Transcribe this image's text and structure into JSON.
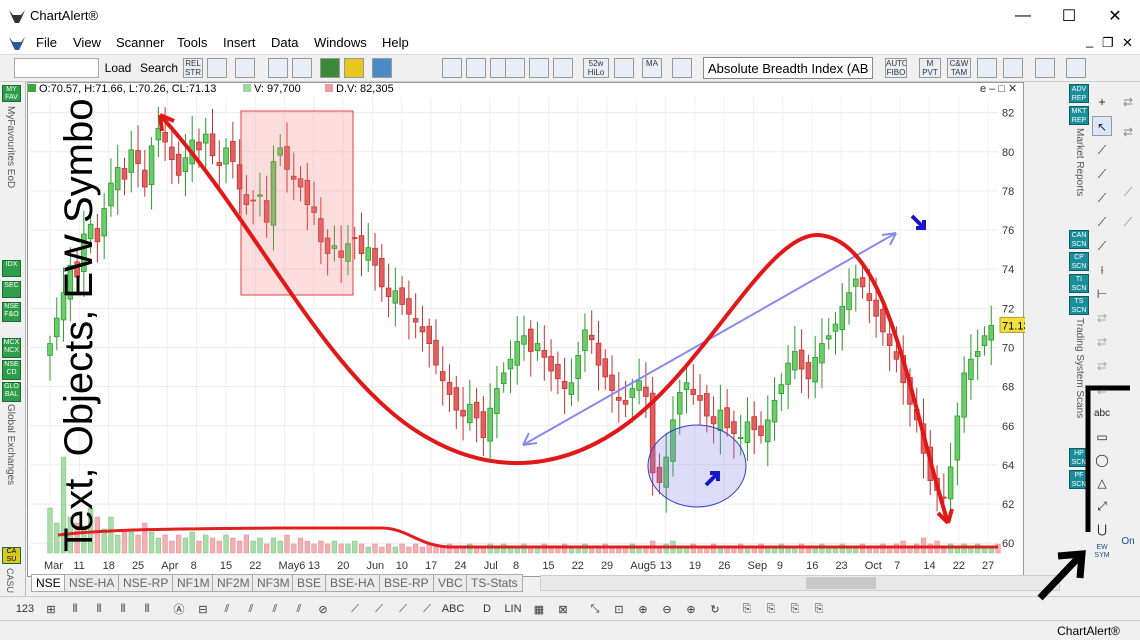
{
  "window": {
    "title": "ChartAlert®",
    "minimize": "—",
    "maximize": "☐",
    "close": "✕"
  },
  "menu": [
    "File",
    "View",
    "Scanner",
    "Tools",
    "Insert",
    "Data",
    "Windows",
    "Help"
  ],
  "menu_right": {
    "min": "_",
    "restore": "❐",
    "close": "✕"
  },
  "toolbar": {
    "load_label": "Load",
    "search_label": "Search",
    "rel_str": "REL STR",
    "hilo": "52w HiLo",
    "ma": "MA",
    "indicator_value": "Absolute Breadth Index (AB",
    "auto_fibo": "AUTO FIBO",
    "mpvt": "M PVT",
    "cam": "C&W TAM"
  },
  "ohlc": {
    "text": "O:70.57, H:71.66, L:70.26, CL:71.13",
    "volume": "V: 97,700",
    "dv": "D.V: 82,305",
    "controls": "e – □ ✕"
  },
  "left_sidebar": {
    "top_button": "MY FAV",
    "label_favourites": "MyFavourites EoD",
    "buttons": [
      "IDX",
      "SEC",
      "NSE F&O",
      "MCX NCX",
      "NSE CD",
      "GLO BAL"
    ],
    "label_global": "Global Exchanges",
    "bottom_button": "CA SU",
    "label_bottom": "CASU"
  },
  "right_panel": {
    "buttons_top": [
      "ADV REP",
      "MKT REP"
    ],
    "label_reports": "Market Reports",
    "buttons_scans": [
      "CAN SCN",
      "CP SCN",
      "TI SCN",
      "TS SCN"
    ],
    "label_scans": "Trading System Scans",
    "buttons_bottom": [
      "HP SCN",
      "PF SCN"
    ],
    "ew_sym": "EW SYM",
    "on_label": "On"
  },
  "draw_tools": [
    "+",
    "↖",
    "⟋",
    "⟋",
    "⟋",
    "⟋",
    "⟋",
    "⟋",
    "⟋",
    "⟊",
    "⊢",
    "⊕",
    "⇄",
    "⇄",
    "⇄",
    "⇄",
    "⇄",
    "abc",
    "▭",
    "◯",
    "△",
    "⤢",
    "⋃"
  ],
  "overlay_caption": "Text, Objects, EW Symbols",
  "price_badge": "71.13",
  "chart_data": {
    "type": "candlestick",
    "y_ticks": [
      60,
      62,
      64,
      66,
      68,
      70,
      72,
      74,
      76,
      78,
      80,
      82
    ],
    "ylim": [
      59.5,
      82.8
    ],
    "x_ticks": [
      "Mar",
      "11",
      "18",
      "25",
      "Apr",
      "8",
      "15",
      "22",
      "May6",
      "13",
      "20",
      "Jun",
      "10",
      "17",
      "24",
      "Jul",
      "8",
      "15",
      "22",
      "29",
      "Aug5",
      "13",
      "19",
      "26",
      "Sep",
      "9",
      "16",
      "23",
      "Oct",
      "7",
      "14",
      "22",
      "27"
    ],
    "closes": [
      70.2,
      71.5,
      72.8,
      74.2,
      73.6,
      75.8,
      76.3,
      75.4,
      77.1,
      78.4,
      79.2,
      78.6,
      80.1,
      79.4,
      78.2,
      80.3,
      81.2,
      80.5,
      79.6,
      78.8,
      79.7,
      80.6,
      80.1,
      80.9,
      79.8,
      79.3,
      80.2,
      79.5,
      78.1,
      77.3,
      77.5,
      77.8,
      76.4,
      79.5,
      80.2,
      79.1,
      78.6,
      78.2,
      77.3,
      76.9,
      75.4,
      74.8,
      75.2,
      74.6,
      75.3,
      75.6,
      74.8,
      75.1,
      74.2,
      73.1,
      72.6,
      72.9,
      72.2,
      71.7,
      71.3,
      70.8,
      70.2,
      69.1,
      68.3,
      67.6,
      66.8,
      66.5,
      67.1,
      66.4,
      65.4,
      66.9,
      67.9,
      68.7,
      69.4,
      70.3,
      70.6,
      69.8,
      70.2,
      69.5,
      68.8,
      68.4,
      67.9,
      68.2,
      69.6,
      70.9,
      70.4,
      69.1,
      68.5,
      67.8,
      67.3,
      67.1,
      67.9,
      68.3,
      67.5,
      63.6,
      63.1,
      64.4,
      66.3,
      67.7,
      68.2,
      67.6,
      67.3,
      66.5,
      66.1,
      66.8,
      65.9,
      65.6,
      65.4,
      66.2,
      65.8,
      65.5,
      66.3,
      67.3,
      68.1,
      69.2,
      69.8,
      68.9,
      68.4,
      69.5,
      70.2,
      70.6,
      71.2,
      72.1,
      72.8,
      73.5,
      73.1,
      72.4,
      71.6,
      70.8,
      70.1,
      69.4,
      68.2,
      67.1,
      66.3,
      64.6,
      63.2,
      62.7,
      62.3,
      63.9,
      66.5,
      68.7,
      69.4,
      69.8,
      70.6,
      71.13
    ],
    "volumes": [
      0.15,
      0.1,
      0.32,
      0.12,
      0.1,
      0.09,
      0.15,
      0.12,
      0.08,
      0.12,
      0.06,
      0.07,
      0.07,
      0.06,
      0.1,
      0.07,
      0.05,
      0.06,
      0.04,
      0.06,
      0.05,
      0.07,
      0.04,
      0.06,
      0.05,
      0.04,
      0.06,
      0.05,
      0.04,
      0.06,
      0.04,
      0.05,
      0.03,
      0.05,
      0.04,
      0.06,
      0.03,
      0.05,
      0.04,
      0.03,
      0.04,
      0.03,
      0.04,
      0.03,
      0.03,
      0.04,
      0.03,
      0.02,
      0.03,
      0.02,
      0.03,
      0.02,
      0.03,
      0.02,
      0.03,
      0.02,
      0.03,
      0.02,
      0.02,
      0.03,
      0.02,
      0.02,
      0.03,
      0.02,
      0.02,
      0.03,
      0.02,
      0.03,
      0.02,
      0.02,
      0.03,
      0.02,
      0.02,
      0.03,
      0.02,
      0.02,
      0.03,
      0.02,
      0.02,
      0.03,
      0.02,
      0.02,
      0.03,
      0.02,
      0.02,
      0.02,
      0.03,
      0.02,
      0.02,
      0.04,
      0.02,
      0.03,
      0.04,
      0.02,
      0.02,
      0.03,
      0.02,
      0.02,
      0.03,
      0.02,
      0.02,
      0.02,
      0.03,
      0.02,
      0.02,
      0.03,
      0.02,
      0.02,
      0.03,
      0.02,
      0.02,
      0.03,
      0.02,
      0.02,
      0.03,
      0.02,
      0.02,
      0.03,
      0.02,
      0.02,
      0.03,
      0.02,
      0.02,
      0.03,
      0.02,
      0.03,
      0.04,
      0.02,
      0.03,
      0.05,
      0.03,
      0.04,
      0.02,
      0.03,
      0.02,
      0.03,
      0.02,
      0.03,
      0.02,
      0.02,
      0.03
    ]
  },
  "exchange_tabs": [
    "NSE",
    "NSE-HA",
    "NSE-RP",
    "NF1M",
    "NF2M",
    "NF3M",
    "BSE",
    "BSE-HA",
    "BSE-RP",
    "VBC",
    "TS-Stats"
  ],
  "bottom_toolbar": [
    "123",
    "⊞",
    "⫴",
    "⫴",
    "⫴",
    "⫴",
    "Ⓐ",
    "⊟",
    "⫽",
    "⫽",
    "⫽",
    "⫽",
    "⊘",
    "⟋",
    "⟋",
    "⟋",
    "⟋",
    "ABC",
    "D",
    "LIN",
    "▦",
    "⊠",
    "⤡",
    "⊡",
    "⊕",
    "⊖",
    "⊕",
    "↻",
    "⎘",
    "⎘",
    "⎘",
    "⎘"
  ],
  "status": {
    "right_text": "ChartAlert®"
  }
}
